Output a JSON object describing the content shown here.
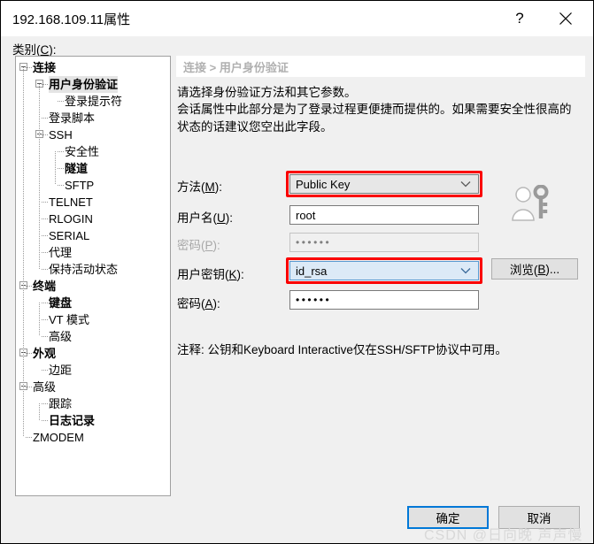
{
  "window": {
    "title": "192.168.109.11属性",
    "help_label": "?",
    "close_label": "✕"
  },
  "category": {
    "label_prefix": "类别(",
    "label_accel": "C",
    "label_suffix": "):"
  },
  "tree": {
    "items": [
      {
        "label": "连接",
        "depth": 0,
        "bold": true,
        "expander": true,
        "selected": false
      },
      {
        "label": "用户身份验证",
        "depth": 1,
        "bold": true,
        "expander": true,
        "selected": true
      },
      {
        "label": "登录提示符",
        "depth": 2,
        "bold": false,
        "expander": false,
        "selected": false
      },
      {
        "label": "登录脚本",
        "depth": 1,
        "bold": false,
        "expander": false,
        "selected": false
      },
      {
        "label": "SSH",
        "depth": 1,
        "bold": false,
        "expander": true,
        "selected": false
      },
      {
        "label": "安全性",
        "depth": 2,
        "bold": false,
        "expander": false,
        "selected": false
      },
      {
        "label": "隧道",
        "depth": 2,
        "bold": true,
        "expander": false,
        "selected": false
      },
      {
        "label": "SFTP",
        "depth": 2,
        "bold": false,
        "expander": false,
        "selected": false
      },
      {
        "label": "TELNET",
        "depth": 1,
        "bold": false,
        "expander": false,
        "selected": false
      },
      {
        "label": "RLOGIN",
        "depth": 1,
        "bold": false,
        "expander": false,
        "selected": false
      },
      {
        "label": "SERIAL",
        "depth": 1,
        "bold": false,
        "expander": false,
        "selected": false
      },
      {
        "label": "代理",
        "depth": 1,
        "bold": false,
        "expander": false,
        "selected": false
      },
      {
        "label": "保持活动状态",
        "depth": 1,
        "bold": false,
        "expander": false,
        "selected": false
      },
      {
        "label": "终端",
        "depth": 0,
        "bold": true,
        "expander": true,
        "selected": false
      },
      {
        "label": "键盘",
        "depth": 1,
        "bold": true,
        "expander": false,
        "selected": false
      },
      {
        "label": "VT 模式",
        "depth": 1,
        "bold": false,
        "expander": false,
        "selected": false
      },
      {
        "label": "高级",
        "depth": 1,
        "bold": false,
        "expander": false,
        "selected": false
      },
      {
        "label": "外观",
        "depth": 0,
        "bold": true,
        "expander": true,
        "selected": false
      },
      {
        "label": "边距",
        "depth": 1,
        "bold": false,
        "expander": false,
        "selected": false
      },
      {
        "label": "高级",
        "depth": 0,
        "bold": false,
        "expander": true,
        "selected": false
      },
      {
        "label": "跟踪",
        "depth": 1,
        "bold": false,
        "expander": false,
        "selected": false
      },
      {
        "label": "日志记录",
        "depth": 1,
        "bold": true,
        "expander": false,
        "selected": false
      },
      {
        "label": "ZMODEM",
        "depth": 0,
        "bold": false,
        "expander": false,
        "selected": false
      }
    ]
  },
  "panel": {
    "breadcrumb": "连接 > 用户身份验证",
    "description_line1": "请选择身份验证方法和其它参数。",
    "description_line2": "会话属性中此部分是为了登录过程更便捷而提供的。如果需要安全性很高的状态的话建议您空出此字段。",
    "note": "注释: 公钥和Keyboard Interactive仅在SSH/SFTP协议中可用。",
    "icon_name": "user-key-icon"
  },
  "form": {
    "method": {
      "label_prefix": "方法(",
      "label_accel": "M",
      "label_suffix": "):",
      "value": "Public Key",
      "highlighted": false
    },
    "username": {
      "label_prefix": "用户名(",
      "label_accel": "U",
      "label_suffix": "):",
      "value": "root"
    },
    "password": {
      "label_prefix": "密码(",
      "label_accel": "P",
      "label_suffix": "):",
      "value": "••••••",
      "disabled": true
    },
    "userkey": {
      "label_prefix": "用户密钥(",
      "label_accel": "K",
      "label_suffix": "):",
      "value": "id_rsa",
      "highlighted": true
    },
    "passphrase": {
      "label_prefix": "密码(",
      "label_accel": "A",
      "label_suffix": "):",
      "value": "••••••"
    },
    "browse": {
      "label_prefix": "浏览(",
      "label_accel": "B",
      "label_suffix": ")..."
    }
  },
  "buttons": {
    "ok": "确定",
    "cancel": "取消"
  },
  "watermark": "CSDN @日向晚 声声慢",
  "colors": {
    "accent": "#0078d7",
    "annotation": "#fa0000",
    "dialog_bg": "#f0f0f0",
    "highlight_field": "#dceaf7"
  }
}
